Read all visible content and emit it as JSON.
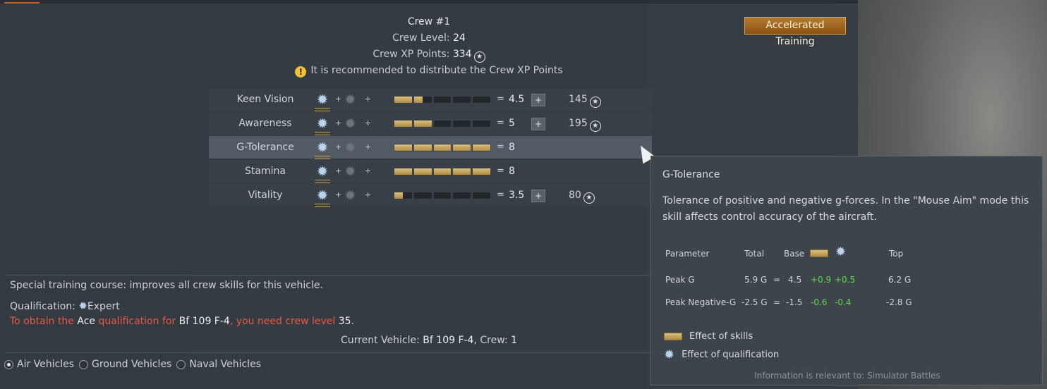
{
  "header": {
    "crew_title": "Crew #1",
    "crew_level_label": "Crew Level:",
    "crew_level": "24",
    "crew_xp_label": "Crew XP Points:",
    "crew_xp": "334",
    "recommendation": "It is recommended to distribute the Crew XP Points",
    "accelerated_training": "Accelerated Training"
  },
  "skills": [
    {
      "name": "Keen Vision",
      "value": "4.5",
      "cost": "145",
      "fill": [
        1,
        0.5,
        0,
        0,
        0
      ]
    },
    {
      "name": "Awareness",
      "value": "5",
      "cost": "195",
      "fill": [
        1,
        1,
        0,
        0,
        0
      ]
    },
    {
      "name": "G-Tolerance",
      "value": "8",
      "cost": "",
      "fill": [
        1,
        1,
        1,
        1,
        1
      ]
    },
    {
      "name": "Stamina",
      "value": "8",
      "cost": "",
      "fill": [
        1,
        1,
        1,
        1,
        1
      ]
    },
    {
      "name": "Vitality",
      "value": "3.5",
      "cost": "80",
      "fill": [
        0.5,
        0,
        0,
        0,
        0
      ]
    }
  ],
  "info": {
    "course": "Special training course: improves all crew skills for this vehicle.",
    "qualification_label": "Qualification:",
    "qualification": "Expert",
    "obtain_1": "To obtain the ",
    "obtain_ace": "Ace",
    "obtain_2": " qualification for ",
    "obtain_vehicle": "Bf 109 F-4",
    "obtain_3": ", you need crew level ",
    "obtain_level": "35",
    "obtain_4": ".",
    "current_label": "Current Vehicle:",
    "current_vehicle": "Bf 109 F-4",
    "crew_label": ", Crew:",
    "crew_num": "1"
  },
  "vehicle_tabs": [
    {
      "label": "Air Vehicles",
      "selected": true
    },
    {
      "label": "Ground Vehicles",
      "selected": false
    },
    {
      "label": "Naval Vehicles",
      "selected": false
    }
  ],
  "tooltip": {
    "title": "G-Tolerance",
    "description": "Tolerance of positive and negative g-forces. In the \"Mouse Aim\" mode this skill affects control accuracy of the aircraft.",
    "col_parameter": "Parameter",
    "col_total": "Total",
    "col_base": "Base",
    "col_top": "Top",
    "rows": [
      {
        "param": "Peak G",
        "total": "5.9 G",
        "eq": "=",
        "base": "4.5",
        "skill": "+0.9",
        "qual": "+0.5",
        "top": "6.2 G"
      },
      {
        "param": "Peak Negative-G",
        "total": "-2.5 G",
        "eq": "=",
        "base": "-1.5",
        "skill": "-0.6",
        "qual": "-0.4",
        "top": "-2.8 G"
      }
    ],
    "legend_skills": "Effect of skills",
    "legend_qual": "Effect of qualification",
    "footer": "Information is relevant to: Simulator Battles"
  },
  "icons": {
    "xp": "star-circle-icon",
    "warning": "exclamation-icon",
    "qualification": "expert-star-icon",
    "ace": "grey-star-icon"
  }
}
